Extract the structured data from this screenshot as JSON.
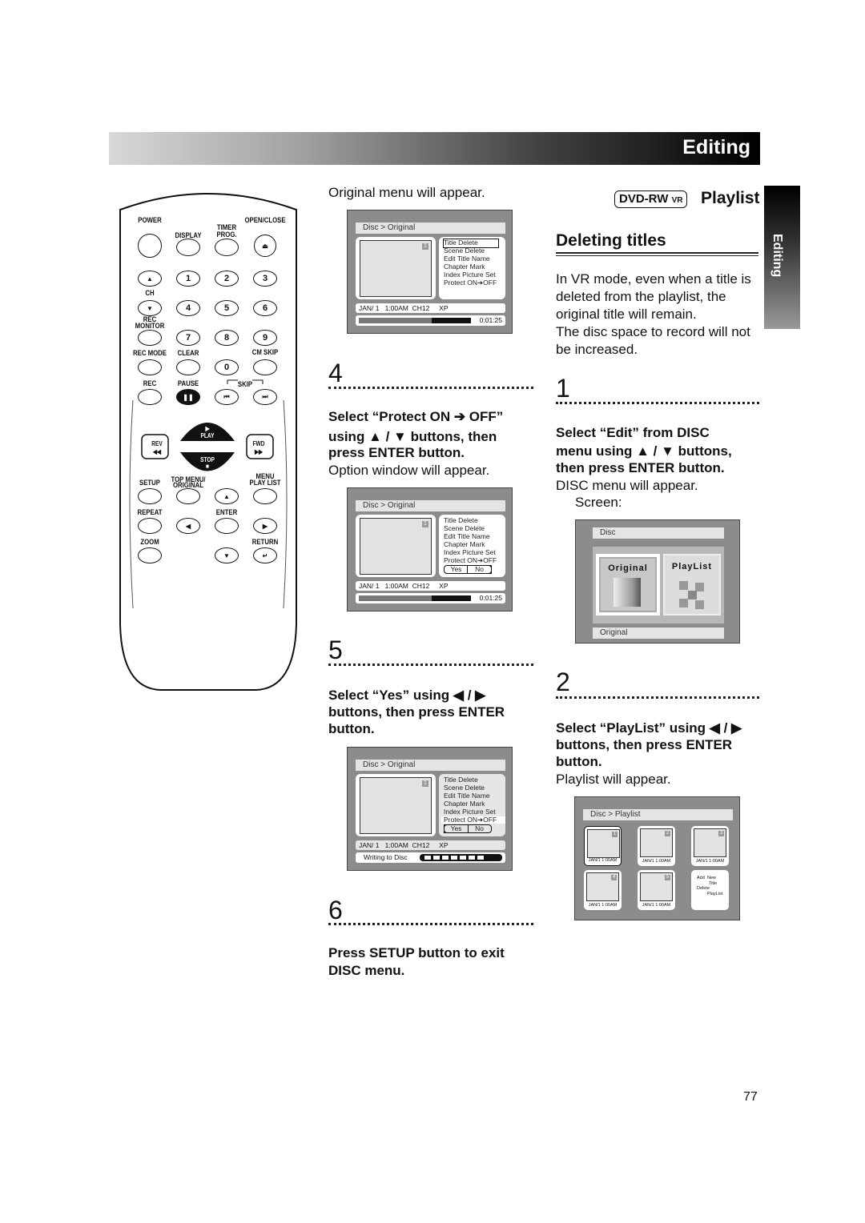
{
  "header": {
    "title": "Editing"
  },
  "side_tab": {
    "label": "Editing"
  },
  "remote": {
    "labels": {
      "power": "POWER",
      "display": "DISPLAY",
      "timer": "TIMER",
      "prog": "PROG.",
      "open_close": "OPEN/CLOSE",
      "ch": "CH",
      "rec_monitor_1": "REC",
      "rec_monitor_2": "MONITOR",
      "rec_mode": "REC MODE",
      "clear": "CLEAR",
      "cm_skip": "CM SKIP",
      "rec": "REC",
      "pause": "PAUSE",
      "skip": "SKIP",
      "play": "PLAY",
      "stop": "STOP",
      "rev": "REV",
      "fwd": "FWD",
      "setup": "SETUP",
      "top_menu_1": "TOP MENU/",
      "top_menu_2": "ORIGINAL",
      "menu_1": "MENU",
      "menu_2": "PLAY LIST",
      "repeat": "REPEAT",
      "enter": "ENTER",
      "zoom": "ZOOM",
      "return": "RETURN"
    },
    "glyphs": {
      "eject": "⏏",
      "ch_up": "▲",
      "ch_down": "▼",
      "n1": "1",
      "n2": "2",
      "n3": "3",
      "n4": "4",
      "n5": "5",
      "n6": "6",
      "n7": "7",
      "n8": "8",
      "n9": "9",
      "n0": "0",
      "pause": "❚❚",
      "skip_back": "⏮",
      "skip_fwd": "⏭",
      "play": "▶",
      "stop": "■",
      "rev": "◀◀",
      "fwd": "▶▶",
      "up": "▲",
      "left": "◀",
      "right": "▶",
      "down": "▼",
      "return": "↵"
    }
  },
  "middle": {
    "intro": "Original menu will appear.",
    "step4": {
      "number": "4",
      "lines": [
        "Select “Protect ON ➔ OFF”",
        "using ▲ / ▼ buttons, then",
        "press ENTER button."
      ],
      "note": "Option window will appear."
    },
    "step5": {
      "number": "5",
      "lines": [
        "Select “Yes” using ◀ / ▶",
        "buttons, then press ENTER",
        "button."
      ]
    },
    "step6": {
      "number": "6",
      "lines": [
        "Press SETUP button to exit",
        "DISC menu."
      ]
    }
  },
  "original_screen": {
    "breadcrumb": "Disc > Original",
    "title_number": "1",
    "menu_items": [
      "Title Delete",
      "Scene Delete",
      "Edit Title Name",
      "Chapter Mark",
      "Index Picture Set",
      "Protect ON➔OFF"
    ],
    "info": "JAN/ 1   1:00AM  CH12     XP",
    "elapsed": "0:01:25",
    "progress": 0.65,
    "yes": "Yes",
    "no": "No",
    "writing": "Writing to Disc"
  },
  "right": {
    "badge_main": "DVD-RW",
    "badge_sub": "VR",
    "section": "Playlist",
    "heading": "Deleting titles",
    "paragraph": [
      "In VR mode, even when a title is",
      "deleted from the playlist, the",
      "original title will remain.",
      "The disc space to record will not",
      "be increased."
    ],
    "step1": {
      "number": "1",
      "lines": [
        "Select “Edit” from DISC",
        "menu using ▲ / ▼ buttons,",
        "then press ENTER button."
      ],
      "note": "DISC menu will appear.",
      "note2": "Screen:"
    },
    "step2": {
      "number": "2",
      "lines": [
        "Select “PlayList” using ◀ / ▶",
        "buttons, then press ENTER",
        "button."
      ],
      "note": "Playlist will appear."
    }
  },
  "disc_screen": {
    "title": "Disc",
    "options": [
      "Original",
      "PlayList"
    ],
    "status": "Original"
  },
  "playlist_screen": {
    "breadcrumb": "Disc > Playlist",
    "titles": [
      {
        "n": "1",
        "date": "JAN/1   1:00AM"
      },
      {
        "n": "2",
        "date": "JAN/1   1:00AM"
      },
      {
        "n": "3",
        "date": "JAN/1   1:00AM"
      },
      {
        "n": "4",
        "date": "JAN/1   1:00AM"
      },
      {
        "n": "5",
        "date": "JAN/1   1:00AM"
      }
    ],
    "actions": {
      "add": "Add",
      "new": "New",
      "title": "Title",
      "delete": "Delete",
      "playlist": "PlayList"
    }
  },
  "page_number": "77"
}
